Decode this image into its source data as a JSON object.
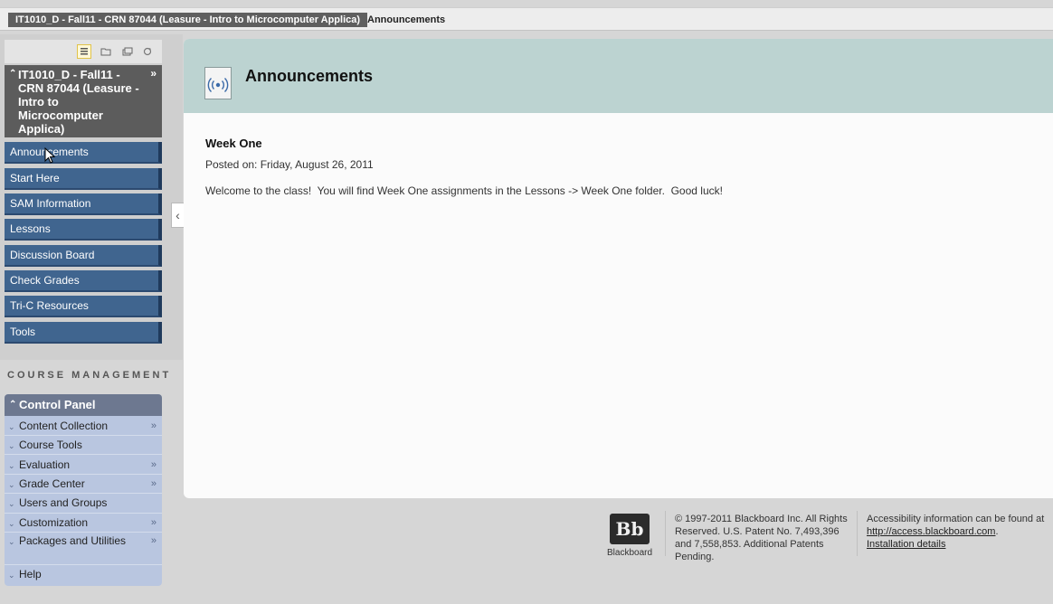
{
  "breadcrumb": {
    "course": "IT1010_D - Fall11 - CRN 87044 (Leasure - Intro to Microcomputer Applica)",
    "current": "Announcements"
  },
  "course_menu": {
    "title": "IT1010_D - Fall11 - CRN 87044 (Leasure - Intro to Microcomputer Applica)",
    "items": [
      {
        "label": "Announcements"
      },
      {
        "label": "Start Here"
      },
      {
        "label": "SAM Information"
      },
      {
        "label": "Lessons"
      },
      {
        "label": "Discussion Board"
      },
      {
        "label": "Check Grades"
      },
      {
        "label": "Tri-C Resources"
      },
      {
        "label": "Tools"
      }
    ]
  },
  "course_management": {
    "title": "COURSE MANAGEMENT",
    "panel_title": "Control Panel",
    "items": [
      {
        "label": "Content Collection"
      },
      {
        "label": "Course Tools"
      },
      {
        "label": "Evaluation"
      },
      {
        "label": "Grade Center"
      },
      {
        "label": "Users and Groups"
      },
      {
        "label": "Customization"
      },
      {
        "label": "Packages and Utilities"
      },
      {
        "label": "Help"
      }
    ]
  },
  "main": {
    "page_title": "Announcements",
    "announcement": {
      "title": "Week One",
      "posted_on": "Posted on: Friday, August 26, 2011",
      "body": "Welcome to the class!  You will find Week One assignments in the Lessons -> Week One folder.  Good luck!"
    }
  },
  "footer": {
    "logo_text": "Bb",
    "logo_word": "Blackboard",
    "copyright": "© 1997-2011 Blackboard Inc. All Rights Reserved. U.S. Patent No. 7,493,396 and 7,558,853. Additional Patents Pending.",
    "accessibility_text": "Accessibility information can be found at",
    "accessibility_link": "http://access.blackboard.com",
    "accessibility_period": ".",
    "installation_link": "Installation details"
  },
  "colors": {
    "nav_item": "#40658f",
    "header_band": "#bcd3d1",
    "control_panel": "#b9c6e0"
  }
}
